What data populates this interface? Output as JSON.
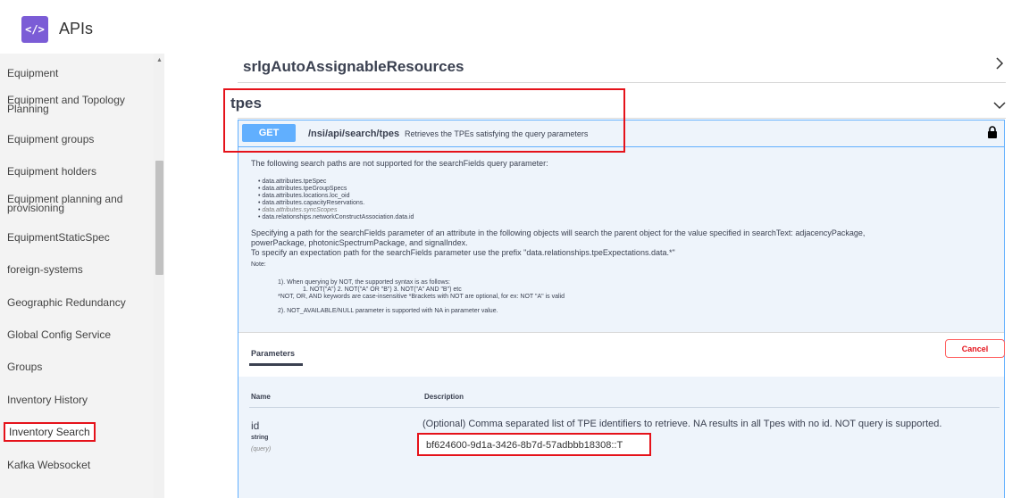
{
  "header": {
    "logo_text": "</>",
    "title": "APIs"
  },
  "sidebar": {
    "items": [
      {
        "label": "Equipment"
      },
      {
        "label": "Equipment and Topology\nPlanning"
      },
      {
        "label": "Equipment groups"
      },
      {
        "label": "Equipment holders"
      },
      {
        "label": "Equipment planning and\nprovisioning"
      },
      {
        "label": "EquipmentStaticSpec"
      },
      {
        "label": "foreign-systems"
      },
      {
        "label": "Geographic Redundancy"
      },
      {
        "label": "Global Config Service"
      },
      {
        "label": "Groups"
      },
      {
        "label": "Inventory History"
      },
      {
        "label": "Inventory Search"
      },
      {
        "label": "Kafka Websocket"
      }
    ],
    "active_item": "Inventory Search"
  },
  "main": {
    "section_prev": {
      "title": "srlgAutoAssignableResources",
      "chevron": "chevron-right-icon"
    },
    "section_current": {
      "title": "tpes",
      "chevron": "chevron-down-icon"
    },
    "operation": {
      "method": "GET",
      "path": "/nsi/api/search/tpes",
      "summary": "Retrieves the TPEs satisfying the query parameters",
      "lock_icon": "lock-icon",
      "description": {
        "intro": "The following search paths are not supported for the searchFields query parameter:",
        "bullets": [
          "data.attributes.tpeSpec",
          "data.attributes.tpeGroupSpecs",
          "data.attributes.locations.loc_oid",
          "data.attributes.capacityReservations.",
          "data.attributes.syncScopes",
          "data.relationships.networkConstructAssociation.data.id"
        ],
        "para1_line1": "Specifying a path for the searchFields parameter of an attribute in the following objects will search the parent object for the value specified in searchText: adjacencyPackage,",
        "para1_line2": "powerPackage, photonicSpectrumPackage, and signalIndex.",
        "para1_line3": "To specify an expectation path for the searchFields parameter use the prefix \"data.relationships.tpeExpectations.data.*\"",
        "note_label": "Note:",
        "note1_line1": "1). When querying by NOT, the supported syntax is as follows:",
        "note1_line2": "1. NOT(\"A\") 2. NOT(\"A\" OR \"B\") 3. NOT(\"A\" AND \"B\") etc",
        "note1_line3": "*NOT, OR, AND keywords are case-insensitive *Brackets with NOT are optional, for ex: NOT \"A\" is valid",
        "note2": "2). NOT_AVAILABLE/NULL parameter is supported with NA in parameter value."
      },
      "parameters": {
        "tab_label": "Parameters",
        "cancel_label": "Cancel",
        "col_name": "Name",
        "col_description": "Description",
        "rows": [
          {
            "name": "id",
            "type": "string",
            "in": "(query)",
            "description": "(Optional) Comma separated list of TPE identifiers to retrieve. NA results in all Tpes with no id. NOT query is supported.",
            "value": "bf624600-9d1a-3426-8b7d-57adbbb18308::T"
          }
        ]
      }
    }
  },
  "colors": {
    "accent": "#61affe",
    "highlight": "#e5121a",
    "logo": "#7b5cd6"
  }
}
